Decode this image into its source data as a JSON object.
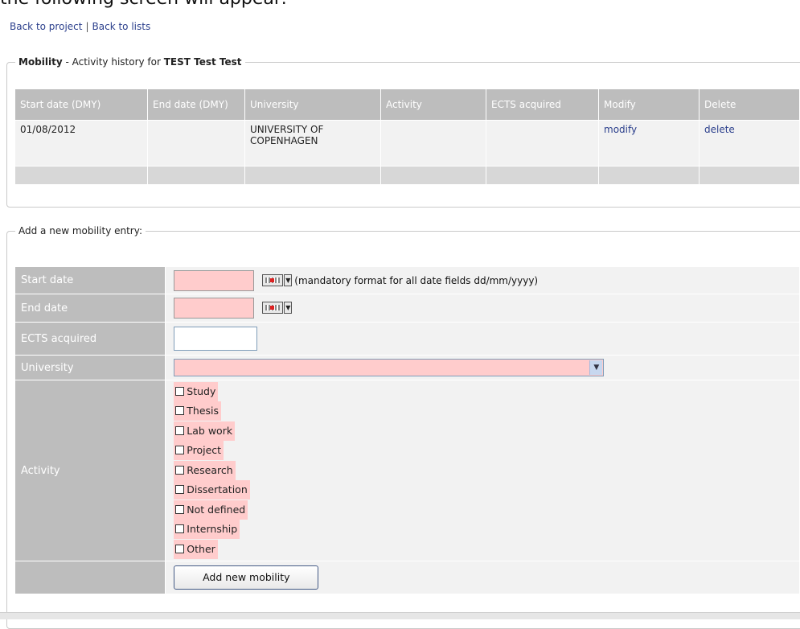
{
  "page_intro_cut": "the following screen will appear:",
  "nav": {
    "back_to_project": "Back to project",
    "separator": "|",
    "back_to_lists": "Back to lists"
  },
  "history": {
    "legend_bold": "Mobility",
    "legend_text": " - Activity history for ",
    "legend_name": "TEST Test Test",
    "columns": [
      "Start date (DMY)",
      "End date (DMY)",
      "University",
      "Activity",
      "ECTS acquired",
      "Modify",
      "Delete"
    ],
    "rows": [
      {
        "start": "01/08/2012",
        "end": "",
        "university": "UNIVERSITY OF COPENHAGEN",
        "activity": "",
        "ects": "",
        "modify": "modify",
        "delete": "delete"
      }
    ]
  },
  "form": {
    "legend": "Add a new mobility entry:",
    "start_label": "Start date",
    "end_label": "End date",
    "ects_label": "ECTS acquired",
    "university_label": "University",
    "activity_label": "Activity",
    "date_hint": "(mandatory format for all date fields dd/mm/yyyy)",
    "activities": [
      "Study",
      "Thesis",
      "Lab work",
      "Project",
      "Research",
      "Dissertation",
      "Not defined",
      "Internship",
      "Other"
    ],
    "submit_label": "Add new mobility"
  },
  "colors": {
    "header_gray": "#bdbdbd",
    "required_pink": "#ffcccc",
    "link_blue": "#2b3f8c"
  }
}
